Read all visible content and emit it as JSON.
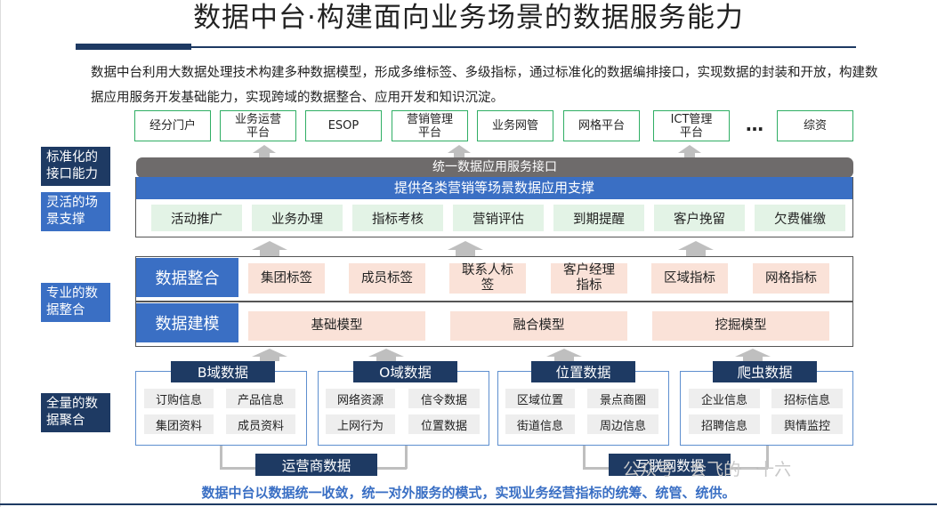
{
  "title": "数据中台·构建面向业务场景的数据服务能力",
  "description": "数据中台利用大数据处理技术构建多种数据模型，形成多维标签、多级指标，通过标准化的数据编排接口，实现数据的封装和开放，构建数据应用服务开发基础能力，实现跨域的数据整合、应用开发和知识沉淀。",
  "apps": [
    "经分门户",
    "业务运营\n平台",
    "ESOP",
    "营销管理\n平台",
    "业务网管",
    "网格平台",
    "ICT管理\n平台",
    "…",
    "综资"
  ],
  "side_labels": {
    "interface": "标准化的\n接口能力",
    "scene": "灵活的场\n景支撑",
    "pro": "专业的数\n据整合",
    "full": "全量的数\n据聚合"
  },
  "interface_bar": "统一数据应用服务接口",
  "scene_header": "提供各类营销等场景数据应用支撑",
  "scenes": [
    "活动推广",
    "业务办理",
    "指标考核",
    "营销评估",
    "到期提醒",
    "客户挽留",
    "欠费催缴"
  ],
  "integration": {
    "label": "数据整合",
    "items": [
      "集团标签",
      "成员标签",
      "联系人标\n签",
      "客户经理\n指标",
      "区域指标",
      "网格指标"
    ]
  },
  "modeling": {
    "label": "数据建模",
    "items": [
      "基础模型",
      "融合模型",
      "挖掘模型"
    ]
  },
  "sources": [
    {
      "name": "B域数据",
      "items": [
        "订购信息",
        "产品信息",
        "集团资料",
        "成员资料"
      ]
    },
    {
      "name": "O域数据",
      "items": [
        "网络资源",
        "信令数据",
        "上网行为",
        "位置数据"
      ]
    },
    {
      "name": "位置数据",
      "items": [
        "区域位置",
        "景点商圈",
        "街道信息",
        "周边信息"
      ]
    },
    {
      "name": "爬虫数据",
      "items": [
        "企业信息",
        "招标信息",
        "招聘信息",
        "舆情监控"
      ]
    }
  ],
  "carrier_data": "运营商数据",
  "internet_data": "互联网数据",
  "footer": "数据中台以数据统一收敛，统一对外服务的模式，实现业务经营指标的统筹、统管、统供。",
  "watermark": "公众号 · 会飞的一十六",
  "colors": {
    "navy": "#1e3a63",
    "blue": "#3a6fc4",
    "green": "#2fae64",
    "gray": "#6e6b6b"
  }
}
